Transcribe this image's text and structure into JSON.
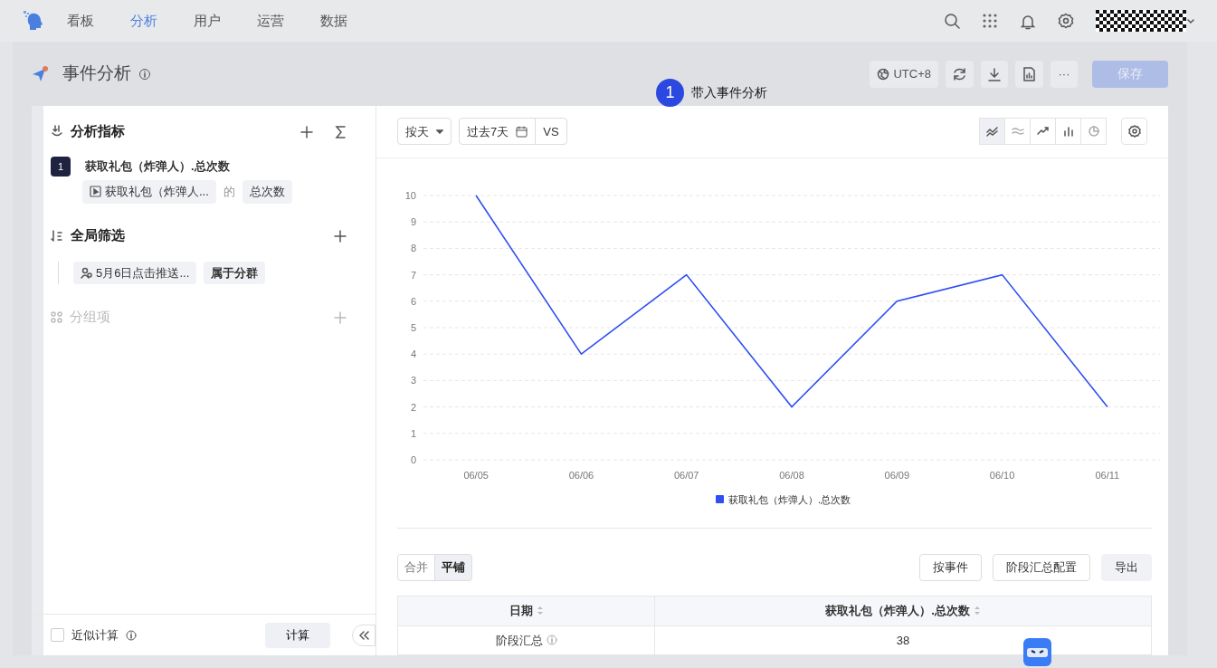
{
  "nav": {
    "tabs": [
      {
        "label": "看板",
        "selected": false
      },
      {
        "label": "分析",
        "selected": true
      },
      {
        "label": "用户",
        "selected": false
      },
      {
        "label": "运营",
        "selected": false
      },
      {
        "label": "数据",
        "selected": false
      }
    ]
  },
  "page": {
    "title": "事件分析",
    "timezone": "UTC+8",
    "more": "···",
    "save_button": {
      "label": "保存",
      "disabled": true
    }
  },
  "tour": {
    "step": "1",
    "text": "带入事件分析"
  },
  "sidebar": {
    "metrics": {
      "title": "分析指标",
      "index": "1",
      "name": "获取礼包（炸弹人）.总次数",
      "event": "获取礼包（炸弹人...",
      "connector": "的",
      "measure": "总次数"
    },
    "filters": {
      "title": "全局筛选",
      "segment": "5月6日点击推送...",
      "operator": "属于分群"
    },
    "grouping": {
      "title": "分组项",
      "disabled": true
    },
    "footer": {
      "approx_label": "近似计算",
      "approx_checked": false,
      "calc_button": "计算"
    }
  },
  "toolbar": {
    "granularity": "按天",
    "date_range": "过去7天",
    "compare": "VS",
    "chart_types": [
      {
        "kind": "line",
        "selected": true
      },
      {
        "kind": "area",
        "selected": false
      },
      {
        "kind": "trend",
        "selected": false
      },
      {
        "kind": "bar",
        "selected": false
      },
      {
        "kind": "pie",
        "selected": false
      }
    ]
  },
  "chart": {
    "chart_data": {
      "type": "line",
      "grid": true,
      "categories": [
        "06/05",
        "06/06",
        "06/07",
        "06/08",
        "06/09",
        "06/10",
        "06/11"
      ],
      "ylim": [
        0,
        10
      ],
      "yticks": [
        0,
        1,
        2,
        3,
        4,
        5,
        6,
        7,
        8,
        9,
        10
      ],
      "series": [
        {
          "name": "获取礼包（炸弹人）.总次数",
          "color": "#2f4ff0",
          "values": [
            10,
            4,
            7,
            2,
            6,
            7,
            2
          ]
        }
      ]
    }
  },
  "table_section": {
    "view_modes": [
      {
        "label": "合并",
        "selected": false
      },
      {
        "label": "平铺",
        "selected": true
      }
    ],
    "buttons": [
      {
        "kind": "outline",
        "label": "按事件"
      },
      {
        "kind": "outline",
        "label": "阶段汇总配置"
      },
      {
        "kind": "filled",
        "label": "导出"
      }
    ],
    "columns": [
      "日期",
      "获取礼包（炸弹人）.总次数"
    ],
    "rows": [
      [
        "阶段汇总",
        "38"
      ]
    ]
  }
}
